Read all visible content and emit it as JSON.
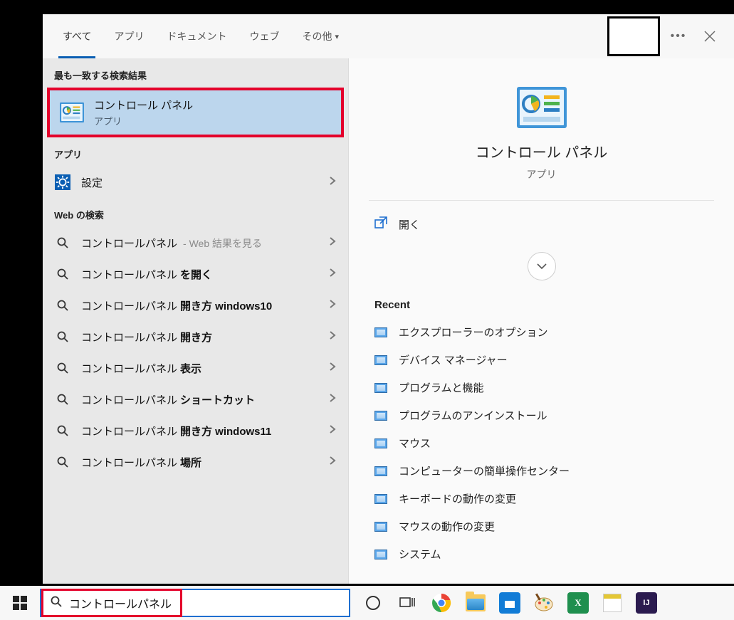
{
  "tabs": {
    "all": "すべて",
    "apps": "アプリ",
    "documents": "ドキュメント",
    "web": "ウェブ",
    "more": "その他"
  },
  "left": {
    "best_match_header": "最も一致する検索結果",
    "best_match_title": "コントロール パネル",
    "best_match_sub": "アプリ",
    "apps_header": "アプリ",
    "settings_label": "設定",
    "web_header": "Web の検索",
    "web": [
      {
        "main": "コントロールパネル",
        "bold": "",
        "hint": " - Web 結果を見る"
      },
      {
        "main": "コントロールパネル",
        "bold": "を開く",
        "hint": ""
      },
      {
        "main": "コントロールパネル ",
        "bold": "開き方 windows10",
        "hint": ""
      },
      {
        "main": "コントロールパネル ",
        "bold": "開き方",
        "hint": ""
      },
      {
        "main": "コントロールパネル ",
        "bold": "表示",
        "hint": ""
      },
      {
        "main": "コントロールパネル ",
        "bold": "ショートカット",
        "hint": ""
      },
      {
        "main": "コントロールパネル ",
        "bold": "開き方 windows11",
        "hint": ""
      },
      {
        "main": "コントロールパネル ",
        "bold": "場所",
        "hint": ""
      }
    ]
  },
  "right": {
    "title": "コントロール パネル",
    "sub": "アプリ",
    "open_label": "開く",
    "recent_header": "Recent",
    "recent": [
      "エクスプローラーのオプション",
      "デバイス マネージャー",
      "プログラムと機能",
      "プログラムのアンインストール",
      "マウス",
      "コンピューターの簡単操作センター",
      "キーボードの動作の変更",
      "マウスの動作の変更",
      "システム"
    ]
  },
  "taskbar": {
    "search_text": "コントロールパネル"
  }
}
